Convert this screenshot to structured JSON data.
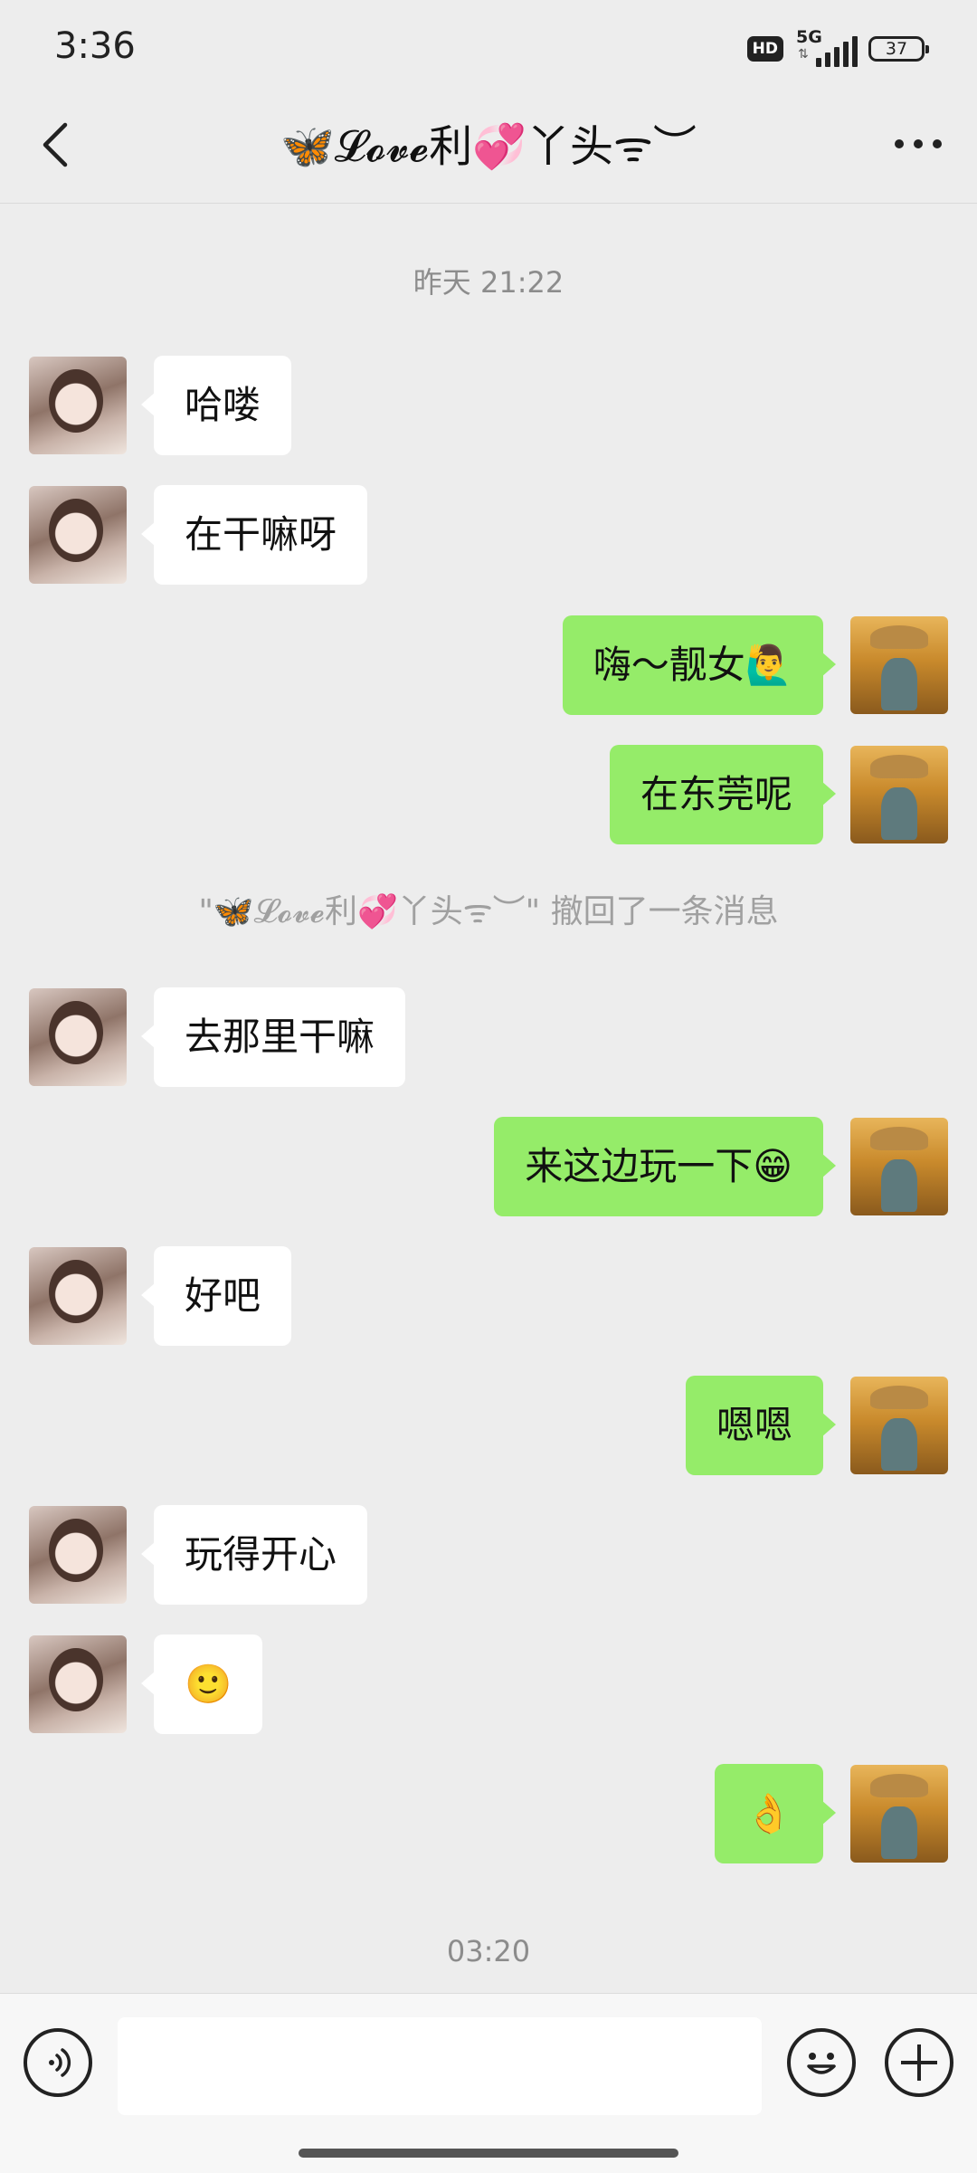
{
  "status_bar": {
    "time": "3:36",
    "hd_label": "HD",
    "network_label": "5G",
    "battery_level": "37"
  },
  "header": {
    "title": "🦋𝓛𝓸𝓿𝓮利💞丫头ᯤ︶",
    "back_icon": "chevron-left-icon",
    "more_icon": "more-horizontal-icon"
  },
  "chat": {
    "timestamp_1": "昨天 21:22",
    "messages": [
      {
        "side": "left",
        "text": "哈喽"
      },
      {
        "side": "left",
        "text": "在干嘛呀"
      },
      {
        "side": "right",
        "text": "嗨～靓女🙋‍♂️"
      },
      {
        "side": "right",
        "text": "在东莞呢"
      },
      {
        "side": "left",
        "text": "去那里干嘛"
      },
      {
        "side": "right",
        "text": "来这边玩一下😁"
      },
      {
        "side": "left",
        "text": "好吧"
      },
      {
        "side": "right",
        "text": "嗯嗯"
      },
      {
        "side": "left",
        "text": "玩得开心"
      },
      {
        "side": "left",
        "text": "🙂"
      },
      {
        "side": "right",
        "text": "👌"
      }
    ],
    "recall_notice": "\"🦋𝓛𝓸𝓿𝓮利💞丫头ᯤ︶\" 撤回了一条消息",
    "timestamp_2": "03:20"
  },
  "input_bar": {
    "voice_icon": "voice-icon",
    "emoji_icon": "emoji-icon",
    "plus_icon": "plus-icon",
    "text_value": ""
  },
  "colors": {
    "background": "#ededed",
    "sent_bubble": "#95ec69",
    "received_bubble": "#ffffff"
  }
}
